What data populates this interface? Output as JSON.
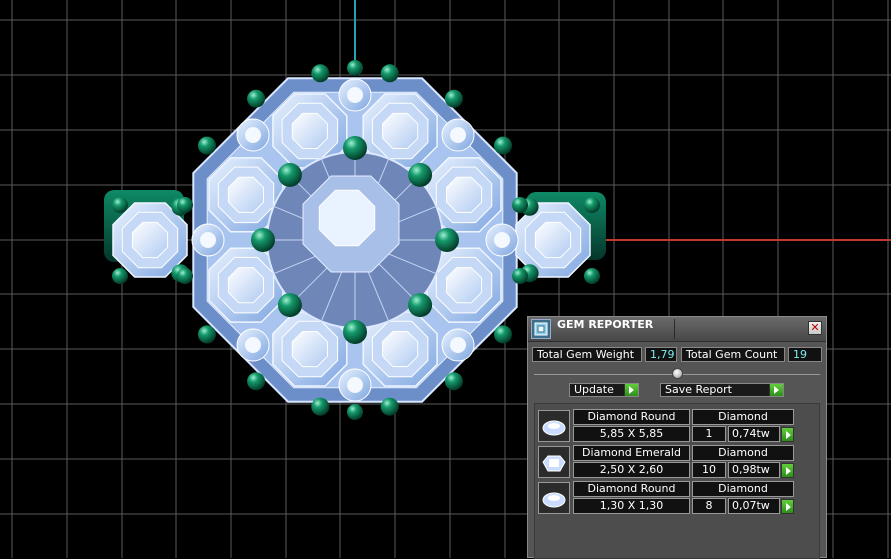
{
  "panel": {
    "title": "GEM REPORTER",
    "close_glyph": "✕",
    "stats": {
      "total_weight_label": "Total Gem Weight",
      "total_weight_value": "1,79",
      "total_count_label": "Total Gem Count",
      "total_count_value": "19"
    },
    "buttons": {
      "update_label": "Update",
      "save_report_label": "Save Report"
    },
    "gems": [
      {
        "shape": "Diamond Round",
        "size": "5,85 X 5,85",
        "material": "Diamond",
        "count": "1",
        "weight": "0,74tw",
        "icon": "round-gem-icon"
      },
      {
        "shape": "Diamond Emerald",
        "size": "2,50 X 2,60",
        "material": "Diamond",
        "count": "10",
        "weight": "0,98tw",
        "icon": "emerald-cut-gem-icon"
      },
      {
        "shape": "Diamond Round",
        "size": "1,30 X 1,30",
        "material": "Diamond",
        "count": "8",
        "weight": "0,07tw",
        "icon": "round-gem-icon"
      }
    ]
  },
  "colors": {
    "background": "#000000",
    "grid": "#5a5a5a",
    "axis_x": "#c0392b",
    "axis_y": "#2aa0b0",
    "metal": "#0d6b50",
    "gem": "#bcd6f7",
    "panel": "#555555",
    "accent_green": "#3fae25"
  }
}
